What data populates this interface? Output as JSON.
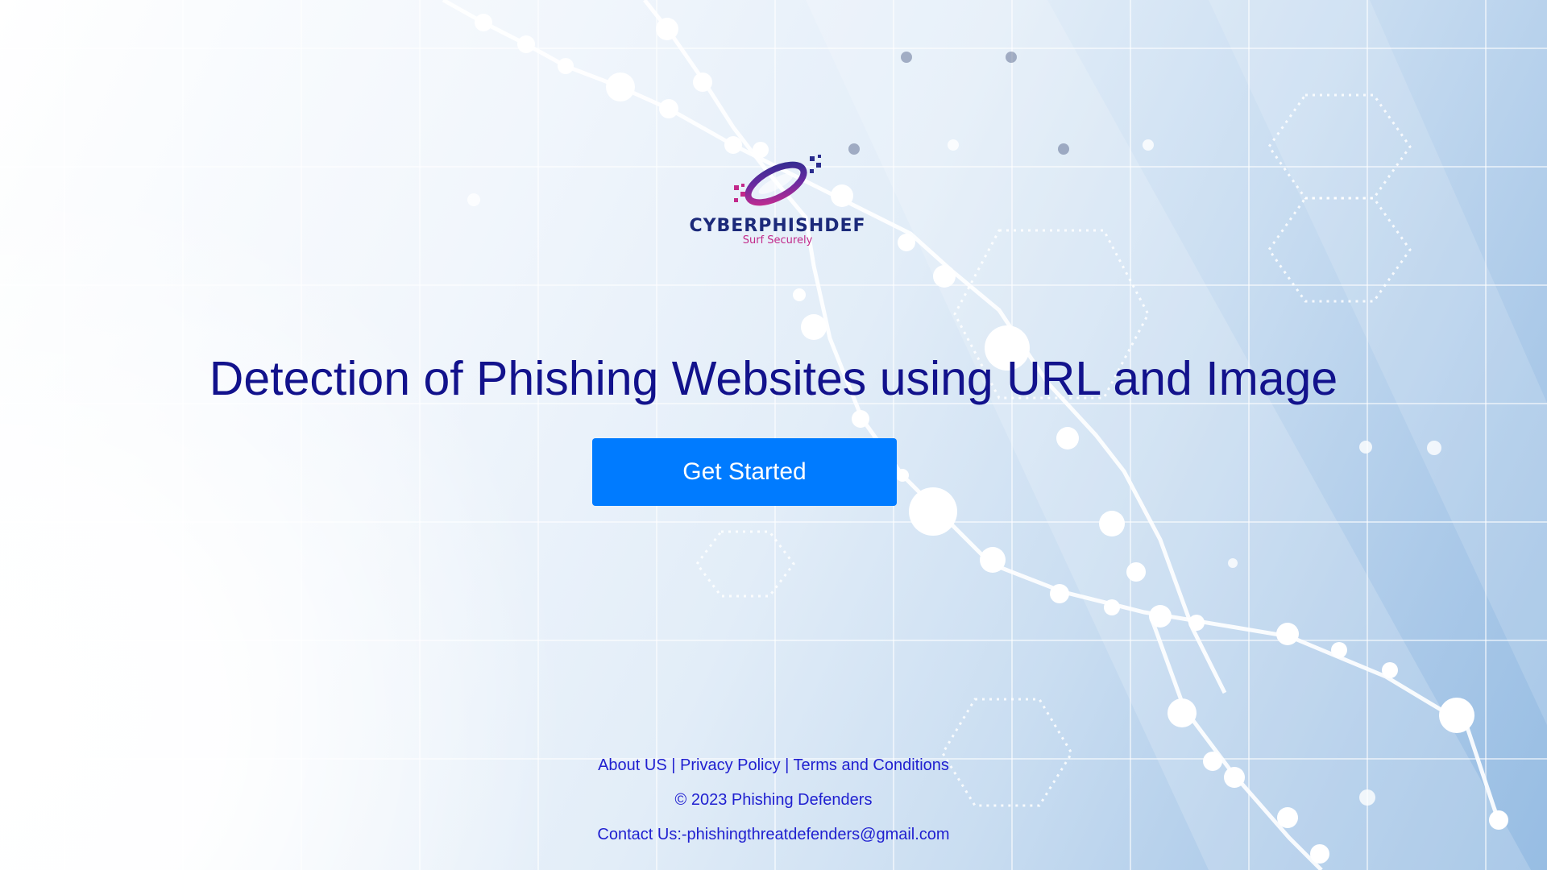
{
  "logo": {
    "name": "CYBERPHISHDEF",
    "tagline": "Surf Securely"
  },
  "hero": {
    "title": "Detection of Phishing Websites using URL and Image",
    "cta_label": "Get Started"
  },
  "footer": {
    "links": [
      "About US",
      "Privacy Policy",
      "Terms and Conditions"
    ],
    "separator": "|",
    "copyright": "© 2023 Phishing Defenders",
    "contact": "Contact Us:-phishingthreatdefenders@gmail.com"
  },
  "colors": {
    "title": "#12128c",
    "cta_bg": "#007bff",
    "footer_text": "#1f1fd0",
    "logo_primary": "#1c2a7a",
    "logo_accent": "#c2298a"
  }
}
